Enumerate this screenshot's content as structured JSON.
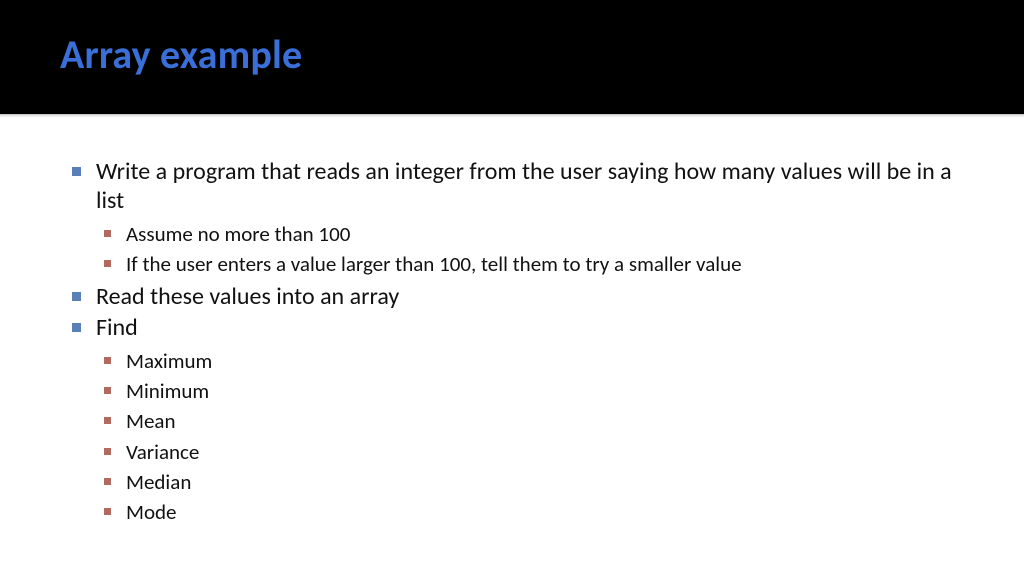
{
  "title": "Array example",
  "bullets": {
    "b1": "Write a program that reads an integer from the user saying how many values will be in a list",
    "b1_sub": {
      "s1": "Assume no more than 100",
      "s2": "If the user enters a value larger than 100, tell them to try a smaller value"
    },
    "b2": "Read these values into an array",
    "b3": "Find",
    "b3_sub": {
      "s1": "Maximum",
      "s2": "Minimum",
      "s3": "Mean",
      "s4": "Variance",
      "s5": "Median",
      "s6": "Mode"
    }
  }
}
